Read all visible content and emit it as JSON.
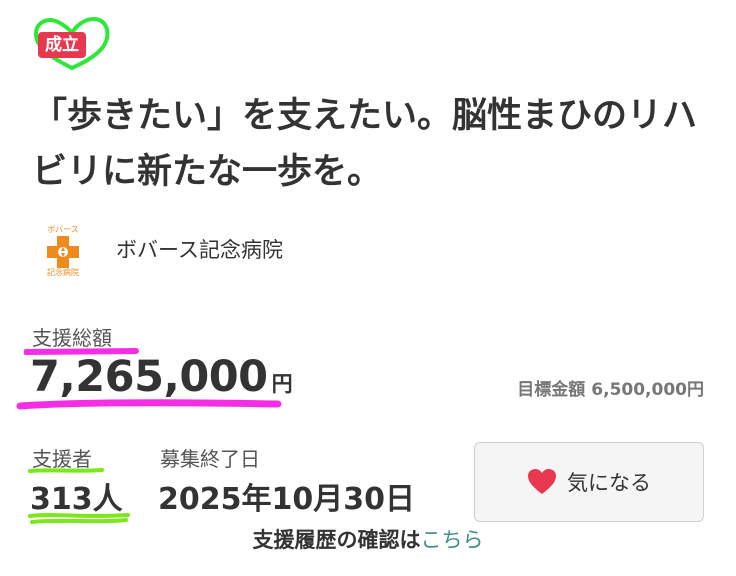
{
  "badge": {
    "label": "成立",
    "accent": "#e8384f",
    "circle_color": "#2ee838"
  },
  "project": {
    "title": "「歩きたい」を支えたい。脳性まひのリハビリに新たな一歩を。"
  },
  "organization": {
    "name": "ボバース記念病院",
    "logo_icon": "hospital-logo-icon",
    "logo_text_top": "ボバース",
    "logo_text_bottom": "記念病院",
    "logo_color": "#f08a1c"
  },
  "funding": {
    "total_label": "支援総額",
    "total_amount": "7,265,000",
    "currency_unit": "円",
    "goal_label": "目標金額",
    "goal_amount": "6,500,000円",
    "highlight_color": "#f52ee6"
  },
  "supporters": {
    "label": "支援者",
    "count": "313人",
    "highlight_color": "#7be81c"
  },
  "deadline": {
    "label": "募集終了日",
    "date": "2025年10月30日"
  },
  "favorite_button": {
    "label": "気になる",
    "icon": "heart-icon",
    "icon_color": "#e8384f"
  },
  "history": {
    "text": "支援履歴の確認は",
    "link_text": "こちら",
    "link_color": "#3f8f86"
  }
}
